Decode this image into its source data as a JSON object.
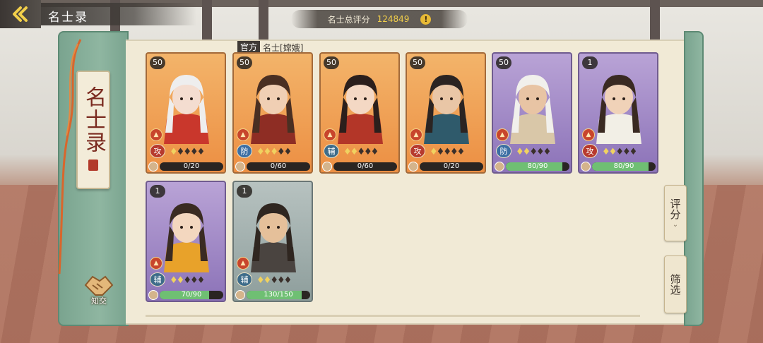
{
  "header": {
    "title": "名士录",
    "score_label": "名士总评分",
    "score_value": "124849",
    "info_icon": "info-icon"
  },
  "book": {
    "title": "名士录",
    "tab_label": "知交"
  },
  "filter": {
    "official": "官方",
    "name": "名士[嫦娥]"
  },
  "cards": [
    {
      "level": "50",
      "role": "攻",
      "stars": 1,
      "progress_value": 0,
      "progress_max": 20,
      "progress_text": "0/20",
      "tier": "orange"
    },
    {
      "level": "50",
      "role": "防",
      "stars": 3,
      "progress_value": 0,
      "progress_max": 60,
      "progress_text": "0/60",
      "tier": "orange"
    },
    {
      "level": "50",
      "role": "辅",
      "stars": 2,
      "progress_value": 0,
      "progress_max": 60,
      "progress_text": "0/60",
      "tier": "orange"
    },
    {
      "level": "50",
      "role": "攻",
      "stars": 1,
      "progress_value": 0,
      "progress_max": 20,
      "progress_text": "0/20",
      "tier": "orange"
    },
    {
      "level": "50",
      "role": "防",
      "stars": 2,
      "progress_value": 80,
      "progress_max": 90,
      "progress_text": "80/90",
      "tier": "purple"
    },
    {
      "level": "1",
      "role": "攻",
      "stars": 2,
      "progress_value": 80,
      "progress_max": 90,
      "progress_text": "80/90",
      "tier": "purple"
    },
    {
      "level": "1",
      "role": "辅",
      "stars": 2,
      "progress_value": 70,
      "progress_max": 90,
      "progress_text": "70/90",
      "tier": "purple"
    },
    {
      "level": "1",
      "role": "辅",
      "stars": 2,
      "progress_value": 130,
      "progress_max": 150,
      "progress_text": "130/150",
      "tier": "gray"
    }
  ],
  "side_buttons": {
    "sort_label": "评分",
    "filter_label": "筛选"
  },
  "colors": {
    "accent_green": "#7aa48f",
    "score_gold": "#f2cf4a",
    "paper": "#f1ead6"
  }
}
